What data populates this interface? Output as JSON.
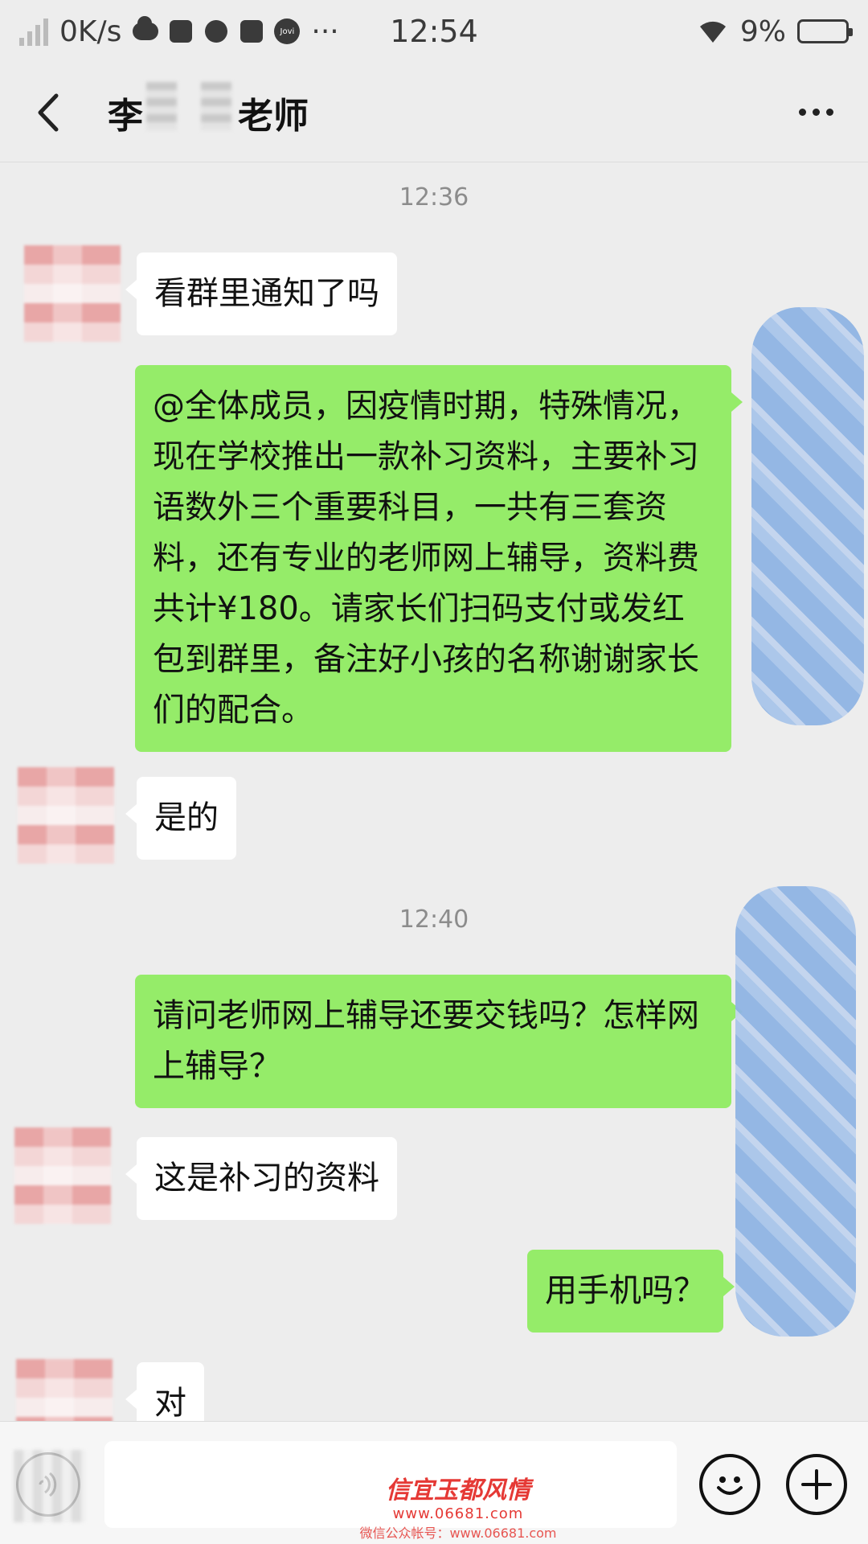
{
  "status_bar": {
    "network_speed": "0K/s",
    "time": "12:54",
    "battery_percent": "9%",
    "more_dots": "···",
    "app_badge": "Jovi",
    "icons": [
      "signal-icon",
      "cloud-icon",
      "app-icon",
      "pinwheel-icon",
      "square-app-icon",
      "jovi-icon",
      "wifi-icon",
      "battery-icon"
    ],
    "battery_level": 0.09,
    "battery_color": "#e53935"
  },
  "nav": {
    "title": "李 老师",
    "title_prefix": "李",
    "title_suffix": "老师",
    "back_icon": "chevron-left-icon",
    "more_icon": "more-dots-icon"
  },
  "chat": {
    "timestamps": [
      "12:36",
      "12:40"
    ],
    "messages": [
      {
        "side": "in",
        "text": "看群里通知了吗"
      },
      {
        "side": "out",
        "text": "@全体成员，因疫情时期，特殊情况，现在学校推出一款补习资料，主要补习语数外三个重要科目，一共有三套资料，还有专业的老师网上辅导，资料费共计¥180。请家长们扫码支付或发红包到群里，备注好小孩的名称谢谢家长们的配合。"
      },
      {
        "side": "in",
        "text": "是的"
      },
      {
        "side": "out",
        "text": "请问老师网上辅导还要交钱吗？怎样网上辅导？"
      },
      {
        "side": "in",
        "text": "这是补习的资料"
      },
      {
        "side": "out",
        "text": "用手机吗？"
      },
      {
        "side": "in",
        "text": "对"
      }
    ],
    "colors": {
      "incoming": "#ffffff",
      "outgoing": "#95ec69",
      "background": "#ededed"
    }
  },
  "input_bar": {
    "placeholder": "",
    "voice_icon": "voice-icon",
    "emoji_icon": "emoji-icon",
    "add_icon": "plus-icon"
  },
  "watermark": {
    "logo_text": "信宜玉都风情",
    "url": "www.06681.com",
    "sub": "微信公众帐号：www.06681.com"
  }
}
